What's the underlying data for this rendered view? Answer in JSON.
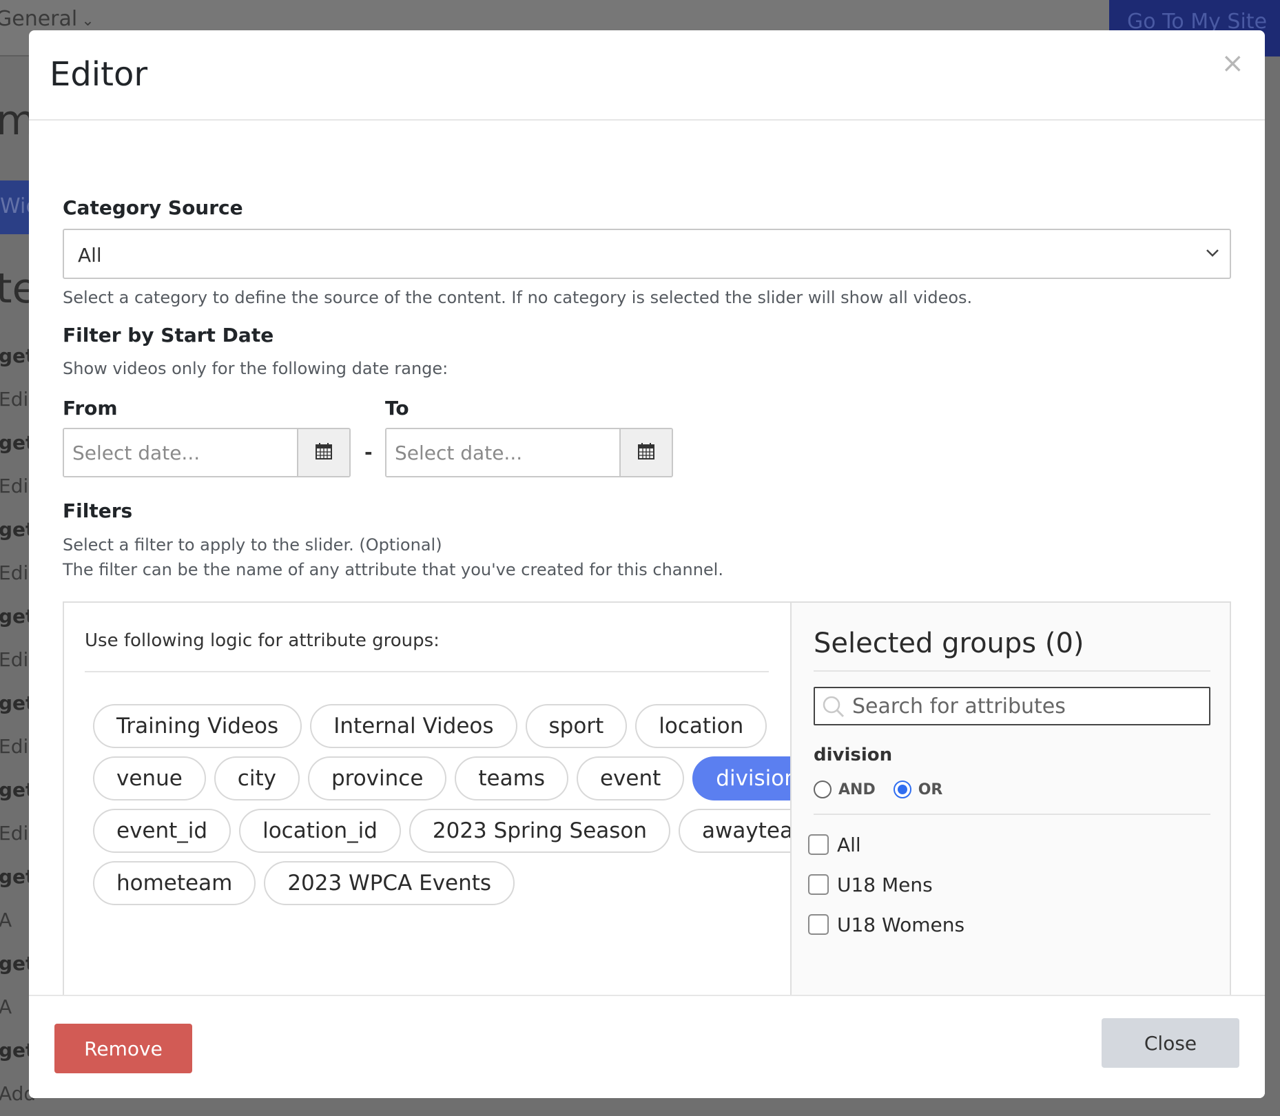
{
  "background": {
    "nav_dropdown": "General",
    "site_button": "Go To My Site",
    "heading_fragment_1": "me",
    "heading_fragment_2": "te",
    "tab_fragment": "Wic",
    "rows": [
      "get",
      "Edi",
      "get",
      "Edi",
      "get",
      "Edi",
      "get",
      "Edi",
      "get",
      "Edi",
      "get",
      "Edi",
      "get",
      "A",
      "get",
      "A",
      "get",
      "Add"
    ]
  },
  "modal": {
    "title": "Editor",
    "close_glyph": "×",
    "category_source": {
      "label": "Category Source",
      "selected": "All",
      "help": "Select a category to define the source of the content. If no category is selected the slider will show all videos."
    },
    "date_filter": {
      "label": "Filter by Start Date",
      "help": "Show videos only for the following date range:",
      "from_label": "From",
      "to_label": "To",
      "from_placeholder": "Select date...",
      "to_placeholder": "Select date...",
      "separator": "-"
    },
    "filters": {
      "label": "Filters",
      "help_line1": "Select a filter to apply to the slider. (Optional)",
      "help_line2": "The filter can be the name of any attribute that you've created for this channel.",
      "logic_label": "Use following logic for attribute groups:",
      "chips": [
        [
          "Training Videos",
          "Internal Videos",
          "sport",
          "location"
        ],
        [
          "venue",
          "city",
          "province",
          "teams",
          "event",
          "division"
        ],
        [
          "event_id",
          "location_id",
          "2023 Spring Season",
          "awayteam"
        ],
        [
          "hometeam",
          "2023 WPCA Events"
        ]
      ],
      "active_chip": "division",
      "selected_groups_title": "Selected groups (0)",
      "search_placeholder": "Search for attributes",
      "group_name": "division",
      "logic_options": [
        {
          "label": "AND",
          "checked": false
        },
        {
          "label": "OR",
          "checked": true
        }
      ],
      "options": [
        {
          "label": "All",
          "checked": false
        },
        {
          "label": "U18 Mens",
          "checked": false
        },
        {
          "label": "U18 Womens",
          "checked": false
        }
      ]
    },
    "footer": {
      "remove_label": "Remove",
      "close_label": "Close"
    }
  },
  "colors": {
    "accent": "#5b7ff0",
    "danger": "#d25b55",
    "radio_checked": "#2f6df0"
  }
}
